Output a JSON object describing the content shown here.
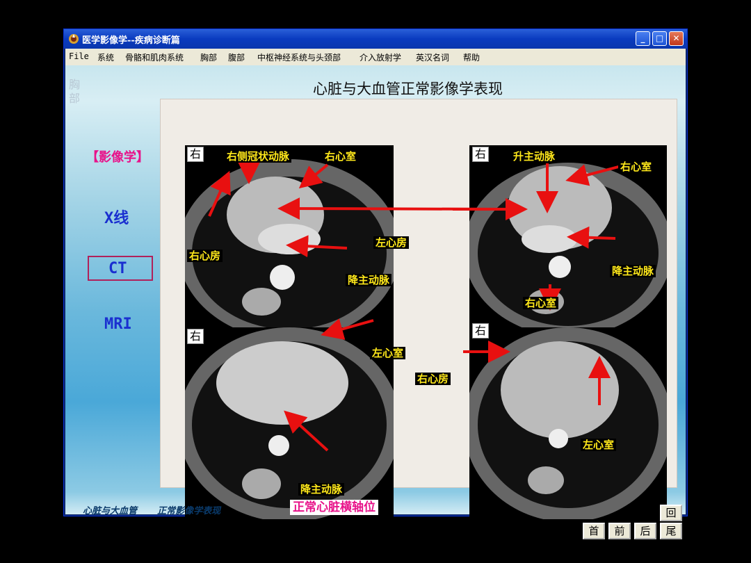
{
  "window": {
    "title": "医学影像学--疾病诊断篇",
    "controls": {
      "minimize": "_",
      "maximize": "□",
      "close": "✕"
    }
  },
  "menu": [
    "File",
    "系统",
    "骨骼和肌肉系统",
    "胸部",
    "腹部",
    "中枢神经系统与头颈部",
    "介入放射学",
    "英汉名词",
    "帮助"
  ],
  "sidebar": {
    "category": "胸部",
    "section": "【影像学】",
    "links": [
      "X线",
      "CT",
      "MRI"
    ],
    "selected": "CT"
  },
  "page_title": "心脏与大血管正常影像学表现",
  "panels": [
    {
      "orientation_label": "右",
      "labels": [
        "右侧冠状动脉",
        "右心室",
        "右心房",
        "左心房",
        "降主动脉"
      ]
    },
    {
      "orientation_label": "右",
      "labels": [
        "升主动脉",
        "右心室",
        "降主动脉",
        "右心室"
      ]
    },
    {
      "orientation_label": "右",
      "labels": [
        "左心室",
        "降主动脉"
      ]
    },
    {
      "orientation_label": "右",
      "labels": [
        "右心房",
        "左心室"
      ]
    }
  ],
  "caption": "正常心脏横轴位",
  "nav": {
    "back": "回",
    "first": "首",
    "prev": "前",
    "next": "后",
    "last": "尾"
  },
  "footer": {
    "part1": "心脏与大血管",
    "part2": "正常影像学表现"
  },
  "colors": {
    "label_text": "#ffe81a",
    "arrow": "#e81010",
    "link": "#1a2fd0",
    "accent": "#e8138a"
  }
}
